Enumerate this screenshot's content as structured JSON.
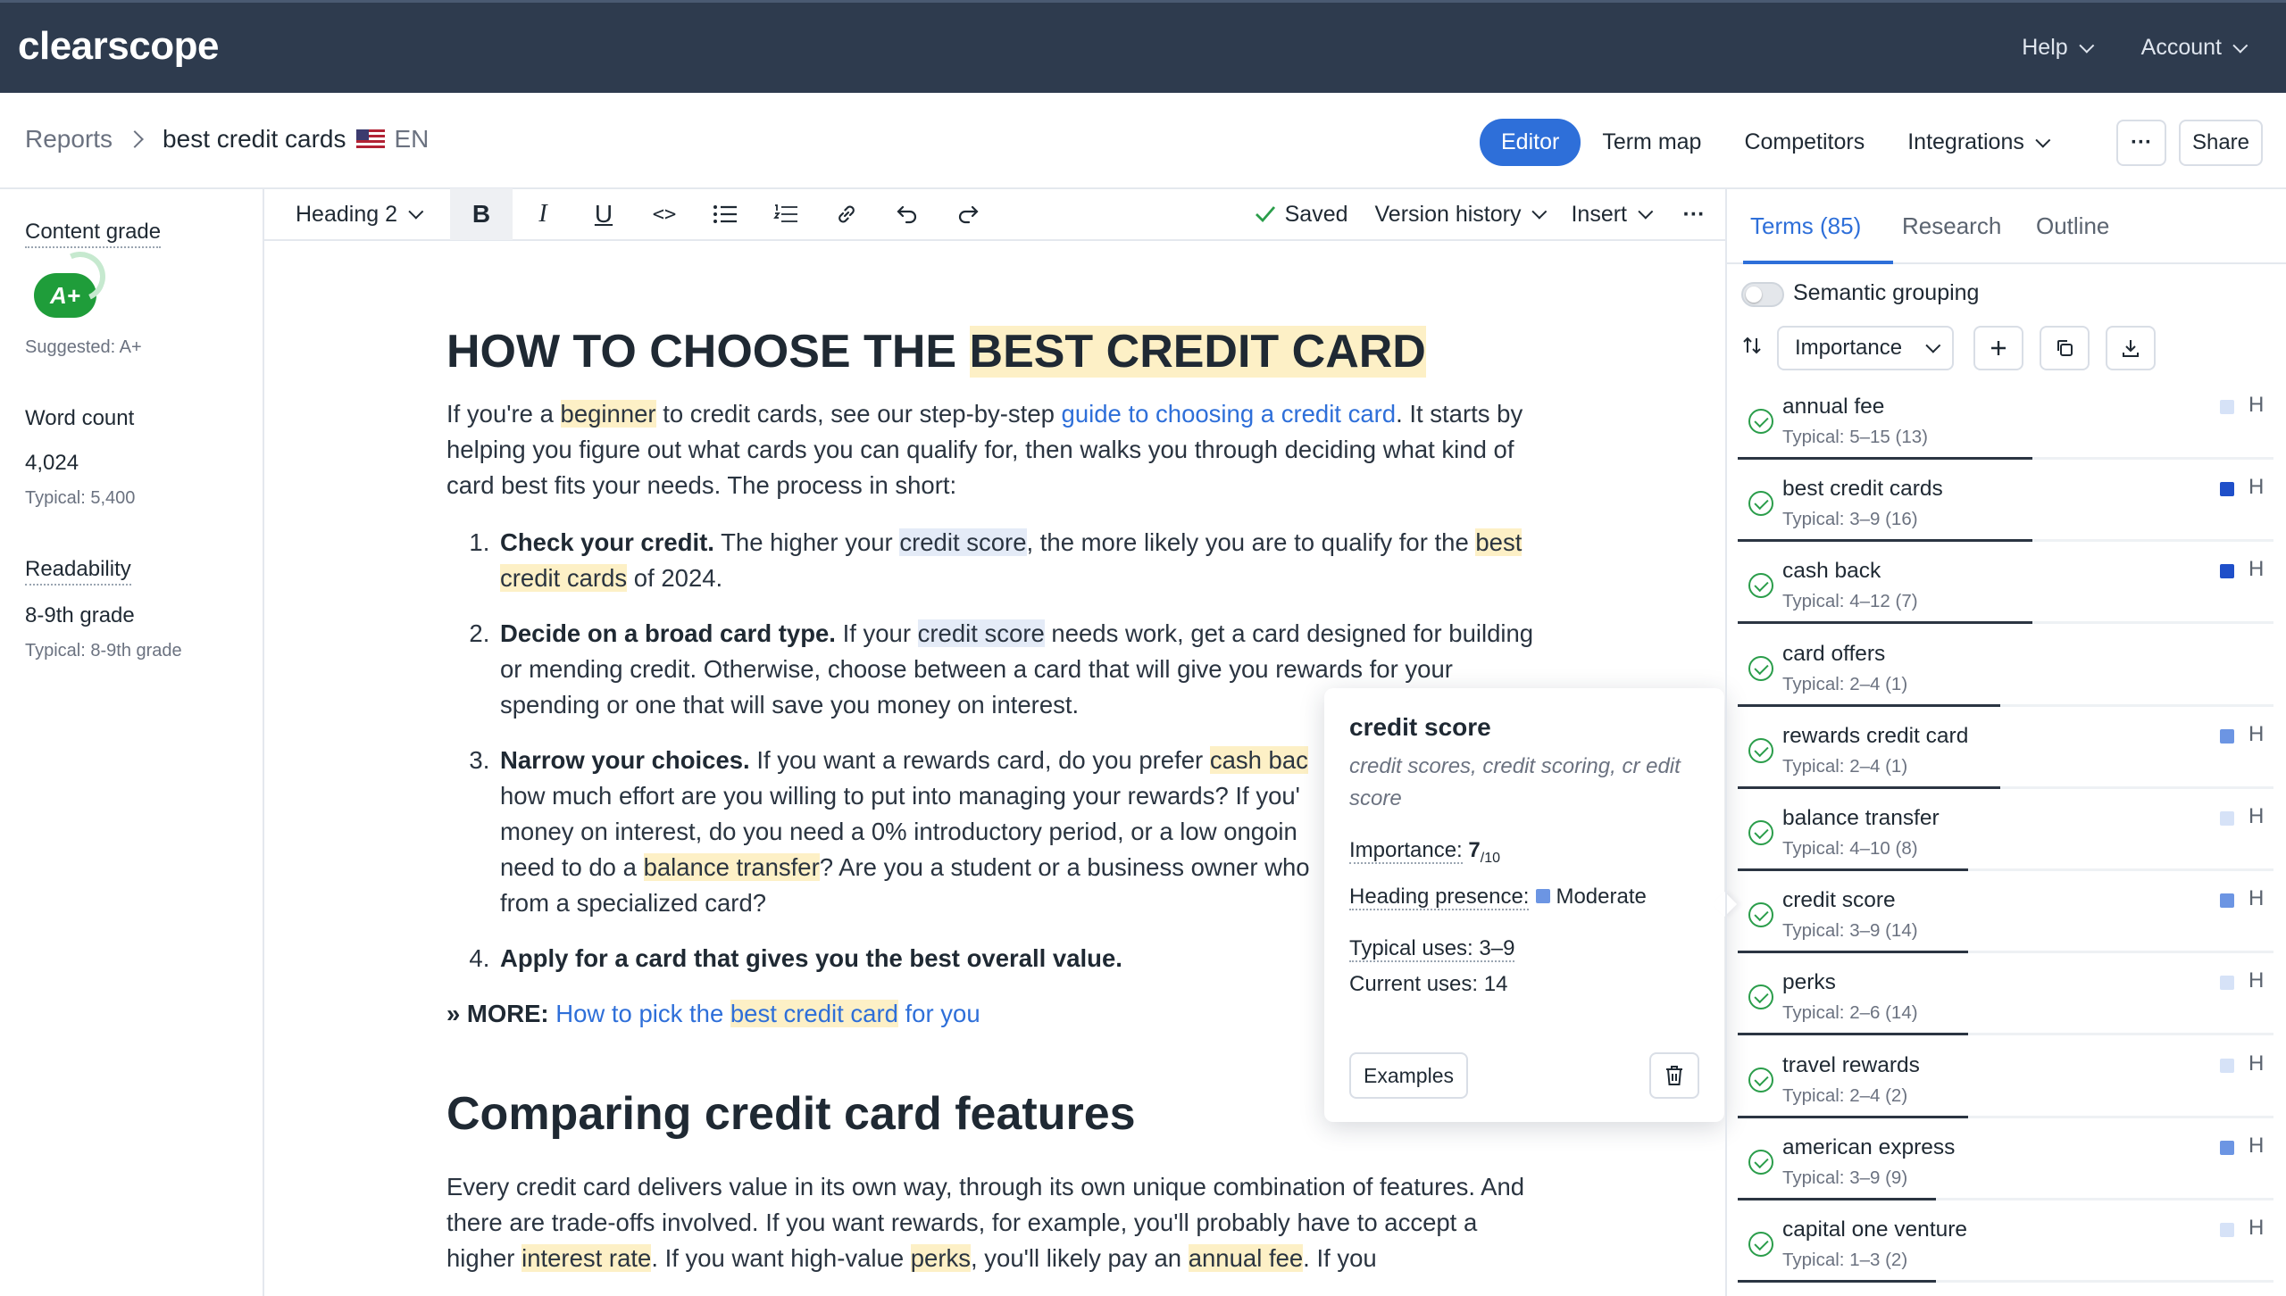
{
  "app": {
    "logo": "clearscope"
  },
  "topnav": {
    "help": "Help",
    "account": "Account"
  },
  "breadcrumb": {
    "reports": "Reports",
    "current": "best credit cards",
    "lang": "EN"
  },
  "header_tabs": {
    "editor": "Editor",
    "term_map": "Term map",
    "competitors": "Competitors",
    "integrations": "Integrations",
    "more": "···",
    "share": "Share"
  },
  "sidebar": {
    "content_grade_label": "Content grade",
    "grade": "A+",
    "suggested": "Suggested: A+",
    "word_count_label": "Word count",
    "word_count": "4,024",
    "word_typical": "Typical: 5,400",
    "readability_label": "Readability",
    "readability": "8-9th grade",
    "readability_typical": "Typical: 8-9th grade"
  },
  "toolbar": {
    "heading": "Heading 2",
    "bold": "B",
    "italic": "I",
    "underline": "U",
    "code": "<>",
    "saved": "Saved",
    "version_history": "Version history",
    "insert": "Insert",
    "more": "···"
  },
  "doc": {
    "h1_a": "HOW TO CHOOSE THE ",
    "h1_b": "BEST CREDIT CARD",
    "p1_a": "If you're a ",
    "p1_b": "beginner",
    "p1_c": " to credit cards, see our step-by-step ",
    "p1_link": "guide to choosing a credit card",
    "p1_d": ". It starts by helping you figure out what cards you can qualify for, then walks you through deciding what kind of card best fits your needs. The process in short:",
    "li1_b": "Check your credit.",
    "li1_a": " The higher your ",
    "li1_c": "credit score",
    "li1_d": ", the more likely you are to qualify for the ",
    "li1_e": "best credit cards",
    "li1_f": " of 2024.",
    "li2_b": "Decide on a broad card type.",
    "li2_a": " If your ",
    "li2_c": "credit score",
    "li2_d": " needs work, get a card designed for building or mending credit. Otherwise, choose between a card that will give you rewards for your spending or one that will save you money on interest.",
    "li3_b": "Narrow your choices.",
    "li3_a": " If you want a rewards card, do you prefer ",
    "li3_c": "cash bac",
    "li3_d": "how much effort are you willing to put into managing your rewards? If you'",
    "li3_e": "money on interest, do you need a 0% introductory period, or a low ongoin",
    "li3_f": "need to do a ",
    "li3_g": "balance transfer",
    "li3_h": "? Are you a student or a business owner who",
    "li3_i": "from a specialized card?",
    "li4_b": "Apply for a card that gives you the best overall value.",
    "more_b": "» MORE:",
    "more_link_a": "How to pick the ",
    "more_link_b": "best credit card",
    "more_link_c": " for you",
    "h2": "Comparing credit card features",
    "p2_a": "Every credit card delivers value in its own way, through its own unique combination of features. And there are trade-offs involved. If you want rewards, for example, you'll probably have to accept a higher ",
    "p2_b": "interest rate",
    "p2_c": ". If you want high-value ",
    "p2_d": "perks",
    "p2_e": ", you'll likely pay an ",
    "p2_f": "annual fee",
    "p2_g": ". If you"
  },
  "popover": {
    "title": "credit score",
    "variants": "credit scores, credit scoring, cr edit score",
    "importance_label": "Importance:",
    "importance_value": "7",
    "importance_denom": "/10",
    "heading_label": "Heading presence:",
    "heading_value": "Moderate",
    "typical": "Typical uses: 3–9",
    "current": "Current uses: 14",
    "examples": "Examples"
  },
  "rightpanel": {
    "tab_terms": "Terms (85)",
    "tab_research": "Research",
    "tab_outline": "Outline",
    "semantic_grouping": "Semantic grouping",
    "sort": "Importance"
  },
  "terms": [
    {
      "name": "annual fee",
      "typical": "Typical: 5–15 (13)",
      "h": "H",
      "heading_color": "#d6e2f7",
      "importance": 0.55
    },
    {
      "name": "best credit cards",
      "typical": "Typical: 3–9 (16)",
      "h": "H",
      "heading_color": "#1f4fc9",
      "importance": 0.55
    },
    {
      "name": "cash back",
      "typical": "Typical: 4–12 (7)",
      "h": "H",
      "heading_color": "#1f4fc9",
      "importance": 0.55
    },
    {
      "name": "card offers",
      "typical": "Typical: 2–4 (1)",
      "h": "",
      "heading_color": "",
      "importance": 0.49
    },
    {
      "name": "rewards credit card",
      "typical": "Typical: 2–4 (1)",
      "h": "H",
      "heading_color": "#6c95e3",
      "importance": 0.49
    },
    {
      "name": "balance transfer",
      "typical": "Typical: 4–10 (8)",
      "h": "H",
      "heading_color": "#d6e2f7",
      "importance": 0.43
    },
    {
      "name": "credit score",
      "typical": "Typical: 3–9 (14)",
      "h": "H",
      "heading_color": "#6c95e3",
      "importance": 0.43
    },
    {
      "name": "perks",
      "typical": "Typical: 2–6 (14)",
      "h": "H",
      "heading_color": "#d6e2f7",
      "importance": 0.43
    },
    {
      "name": "travel rewards",
      "typical": "Typical: 2–4 (2)",
      "h": "H",
      "heading_color": "#d6e2f7",
      "importance": 0.43
    },
    {
      "name": "american express",
      "typical": "Typical: 3–9 (9)",
      "h": "H",
      "heading_color": "#6c95e3",
      "importance": 0.37
    },
    {
      "name": "capital one venture",
      "typical": "Typical: 1–3 (2)",
      "h": "H",
      "heading_color": "#d6e2f7",
      "importance": 0.37
    }
  ]
}
